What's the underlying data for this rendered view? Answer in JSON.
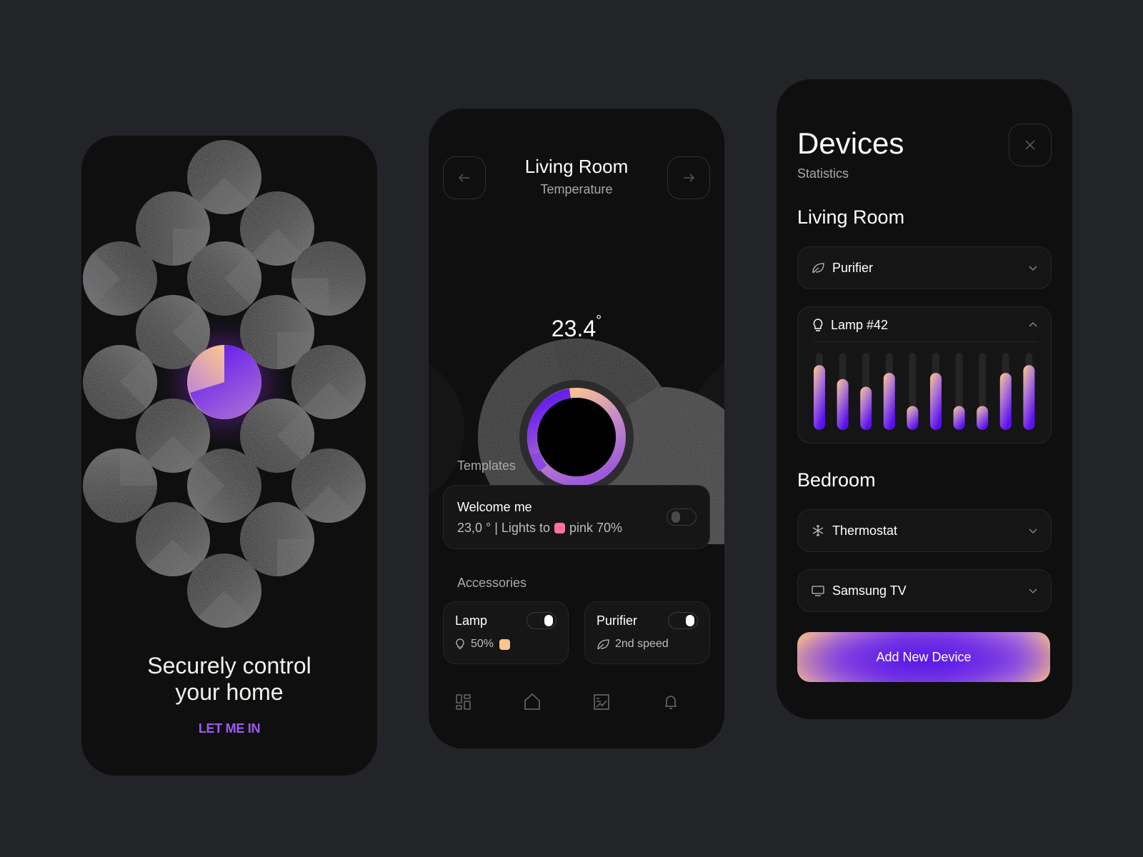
{
  "onboarding": {
    "headline_line1": "Securely control",
    "headline_line2": "your home",
    "cta_label": "LET ME IN",
    "accent_color": "#9b5cf0"
  },
  "room_screen": {
    "title": "Living Room",
    "subtitle": "Temperature",
    "prev_icon": "arrow-left-icon",
    "next_icon": "arrow-right-icon",
    "temperature_value": "23.4",
    "temperature_unit": "°",
    "templates_heading": "Templates",
    "template": {
      "name": "Welcome me",
      "detail_prefix": "23,0 ° | Lights to",
      "color_swatch": "#ff6fa4",
      "detail_suffix": "pink 70%",
      "enabled": false
    },
    "accessories_heading": "Accessories",
    "accessories": [
      {
        "name": "Lamp",
        "icon": "bulb-icon",
        "detail": "50%",
        "swatch": "#ffc58a",
        "enabled": true
      },
      {
        "name": "Purifier",
        "icon": "leaf-icon",
        "detail": "2nd speed",
        "enabled": true
      }
    ],
    "bottom_nav": [
      {
        "icon": "dashboard-icon"
      },
      {
        "icon": "home-icon"
      },
      {
        "icon": "stats-icon"
      },
      {
        "icon": "bell-icon"
      }
    ]
  },
  "devices_screen": {
    "title": "Devices",
    "subtitle": "Statistics",
    "close_icon": "close-icon",
    "rooms": [
      {
        "name": "Living Room",
        "devices": [
          {
            "name": "Purifier",
            "icon": "leaf-icon",
            "expanded": false
          },
          {
            "name": "Lamp #42",
            "icon": "bulb-icon",
            "expanded": true,
            "usage_levels": [
              0.84,
              0.66,
              0.56,
              0.74,
              0.31,
              0.74,
              0.31,
              0.31,
              0.74,
              0.84
            ]
          }
        ]
      },
      {
        "name": "Bedroom",
        "devices": [
          {
            "name": "Thermostat",
            "icon": "snowflake-icon",
            "expanded": false
          },
          {
            "name": "Samsung TV",
            "icon": "tv-icon",
            "expanded": false
          }
        ]
      }
    ],
    "add_button_label": "Add New Device"
  },
  "colors": {
    "background": "#232427",
    "panel": "#0f0f10",
    "gradient_peach": "#ffc98a",
    "gradient_violet": "#5a10f0"
  }
}
